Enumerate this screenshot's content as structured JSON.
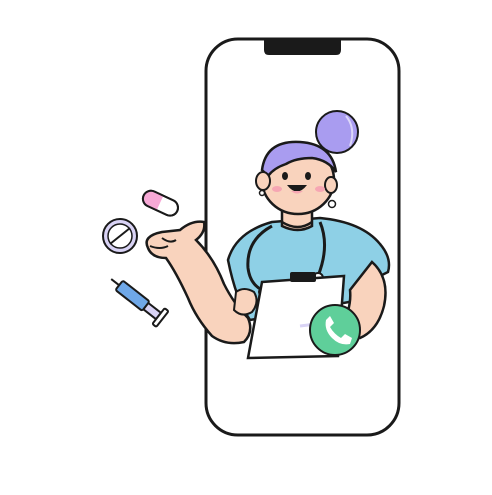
{
  "illustration": {
    "subject": "telemedicine-doctor-in-phone",
    "colors": {
      "outline": "#1a1a1a",
      "phone_screen": "#ffffff",
      "scrubs": "#8ed0e6",
      "hair_cap": "#a99cf0",
      "skin": "#f9d3bd",
      "skin_shadow": "#f2b79c",
      "cheek": "#f6a6b3",
      "clipboard": "#ffffff",
      "call_button": "#5fcf9a",
      "pill_pink": "#f7a9d6",
      "pill_lavender": "#d9d3f5",
      "syringe_blue": "#6fa8e8"
    },
    "icons": [
      "phone-handset-icon",
      "capsule-icon",
      "tablet-pill-icon",
      "syringe-icon"
    ]
  }
}
